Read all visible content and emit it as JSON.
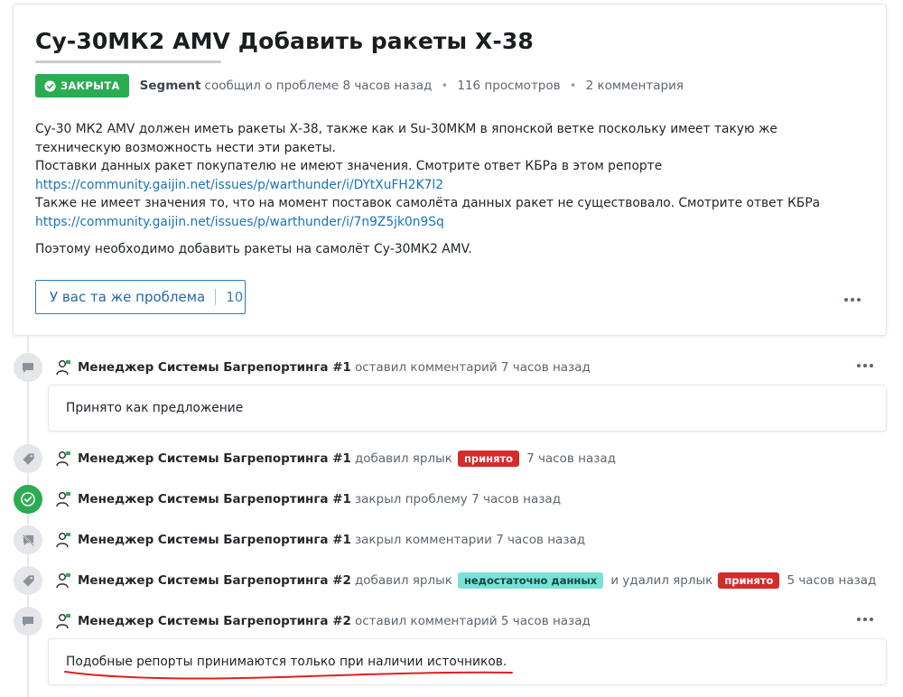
{
  "issue": {
    "title": "Су-30МК2 AMV Добавить ракеты Х-38",
    "status_label": "ЗАКРЫТА",
    "author": "Segment",
    "reported_text": "сообщил о проблеме 8 часов назад",
    "views": "116 просмотров",
    "comments": "2 комментария",
    "body": {
      "p1": "Су-30 МК2 AMV должен иметь ракеты Х-38, также как и Su-30MKM в японской ветке поскольку имеет такую же техническую возможность нести эти ракеты.",
      "p2": "Поставки данных ракет покупателю не имеют значения. Смотрите ответ КБРа в этом репорте",
      "link1": "https://community.gaijin.net/issues/p/warthunder/i/DYtXuFH2K7l2",
      "p3": "Также не имеет значения то, что на момент поставок самолёта данных ракет не существовало. Смотрите ответ КБРа",
      "link2": "https://community.gaijin.net/issues/p/warthunder/i/7n9Z5jk0n9Sq",
      "p4": "Поэтому необходимо добавить ракеты на самолёт Су-30МК2 AMV."
    },
    "same_problem_label": "У вас та же проблема",
    "same_problem_count": "10"
  },
  "timeline": {
    "ev1": {
      "actor": "Менеджер Системы Багрепортинга #1",
      "action": "оставил комментарий 7 часов назад",
      "comment": "Принято как предложение"
    },
    "ev2": {
      "actor": "Менеджер Системы Багрепортинга #1",
      "action": "добавил ярлык",
      "tag": "принято",
      "time": "7 часов назад"
    },
    "ev3": {
      "actor": "Менеджер Системы Багрепортинга #1",
      "action": "закрыл проблему 7 часов назад"
    },
    "ev4": {
      "actor": "Менеджер Системы Багрепортинга #1",
      "action": "закрыл комментарии 7 часов назад"
    },
    "ev5": {
      "actor": "Менеджер Системы Багрепортинга #2",
      "action": "добавил ярлык",
      "tag_added": "недостаточно данных",
      "action2": "и удалил ярлык",
      "tag_removed": "принято",
      "time": "5 часов назад"
    },
    "ev6": {
      "actor": "Менеджер Системы Багрепортинга #2",
      "action": "оставил комментарий 5 часов назад",
      "comment": "Подобные репорты принимаются только при наличии источников."
    }
  },
  "colors": {
    "closed_badge": "#2bac52",
    "tag_red": "#d42b2b",
    "tag_teal": "#79e2d6",
    "link": "#1a73b8",
    "annotation_underline": "#e02020"
  },
  "icons": [
    "check-circle-icon",
    "comment-icon",
    "tag-icon",
    "comments-disabled-icon",
    "manager-avatar-icon",
    "more-icon"
  ]
}
